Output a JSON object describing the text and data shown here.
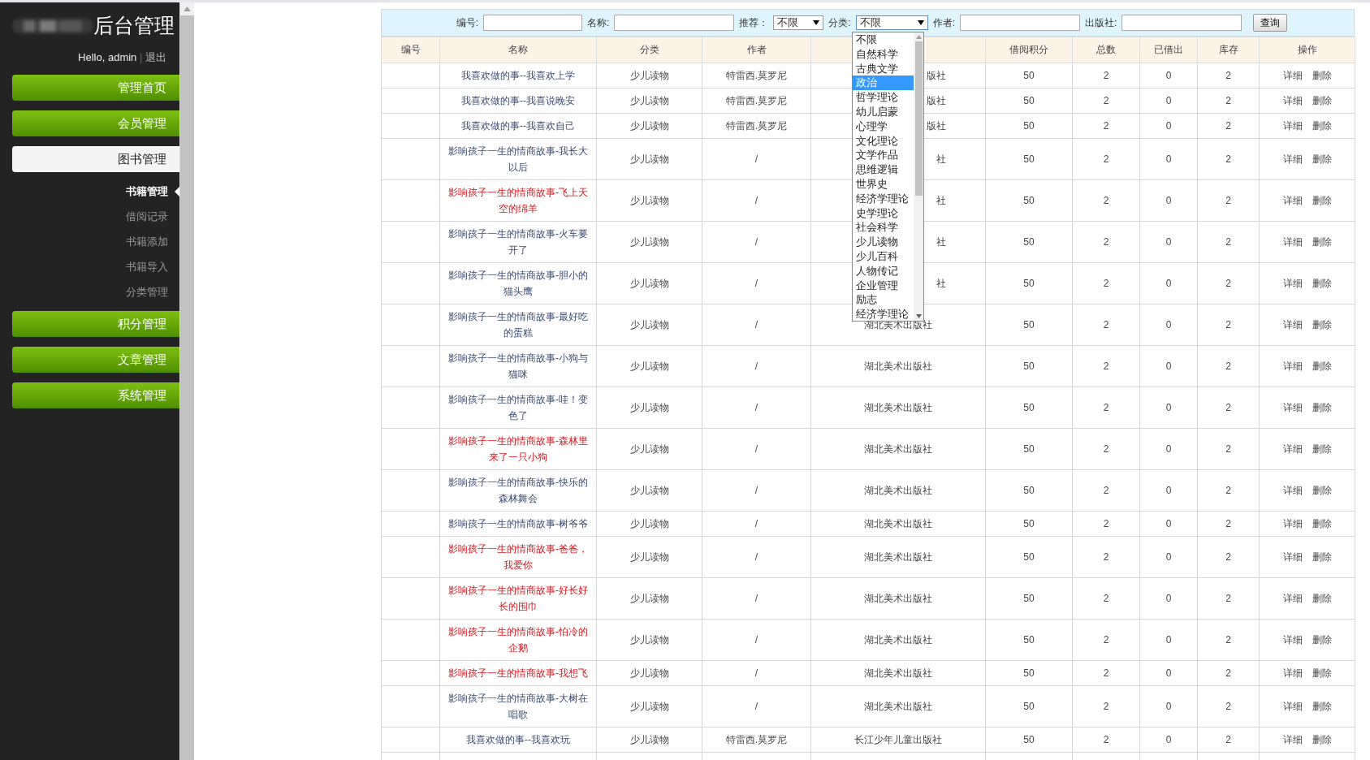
{
  "sidebar": {
    "title": "后台管理",
    "greeting": "Hello, admin",
    "separator": "|",
    "logout": "退出",
    "menu": [
      {
        "label": "管理首页",
        "selected": false
      },
      {
        "label": "会员管理",
        "selected": false
      },
      {
        "label": "图书管理",
        "selected": true,
        "children": [
          {
            "label": "书籍管理",
            "selected": true
          },
          {
            "label": "借阅记录",
            "selected": false
          },
          {
            "label": "书籍添加",
            "selected": false
          },
          {
            "label": "书籍导入",
            "selected": false
          },
          {
            "label": "分类管理",
            "selected": false
          }
        ]
      },
      {
        "label": "积分管理",
        "selected": false
      },
      {
        "label": "文章管理",
        "selected": false
      },
      {
        "label": "系统管理",
        "selected": false
      }
    ]
  },
  "search": {
    "fields": [
      {
        "kind": "input",
        "label": "编号:"
      },
      {
        "kind": "input",
        "label": "名称:"
      },
      {
        "kind": "select",
        "label": "推荐：",
        "value": "不限"
      },
      {
        "kind": "select",
        "label": "分类:",
        "value": "不限",
        "expanded": true
      },
      {
        "kind": "input",
        "label": "作者:"
      },
      {
        "kind": "input",
        "label": "出版社:"
      }
    ],
    "button": "查询",
    "options": [
      {
        "label": "不限",
        "selected": false
      },
      {
        "label": "自然科学",
        "selected": false
      },
      {
        "label": "古典文学",
        "selected": false
      },
      {
        "label": "政治",
        "selected": true
      },
      {
        "label": "哲学理论",
        "selected": false
      },
      {
        "label": "幼儿启蒙",
        "selected": false
      },
      {
        "label": "心理学",
        "selected": false
      },
      {
        "label": "文化理论",
        "selected": false
      },
      {
        "label": "文学作品",
        "selected": false
      },
      {
        "label": "思维逻辑",
        "selected": false
      },
      {
        "label": "世界史",
        "selected": false
      },
      {
        "label": "经济学理论",
        "selected": false
      },
      {
        "label": "史学理论",
        "selected": false
      },
      {
        "label": "社会科学",
        "selected": false
      },
      {
        "label": "少儿读物",
        "selected": false
      },
      {
        "label": "少儿百科",
        "selected": false
      },
      {
        "label": "人物传记",
        "selected": false
      },
      {
        "label": "企业管理",
        "selected": false
      },
      {
        "label": "励志",
        "selected": false
      },
      {
        "label": "经济学理论",
        "selected": false
      }
    ]
  },
  "table": {
    "columns": [
      {
        "label": "编号"
      },
      {
        "label": "名称"
      },
      {
        "label": "分类"
      },
      {
        "label": "作者"
      },
      {},
      {
        "label": "借阅积分"
      },
      {
        "label": "总数"
      },
      {
        "label": "已借出"
      },
      {
        "label": "库存"
      },
      {
        "label": "操作"
      }
    ],
    "rows": [
      {
        "name": "我喜欢做的事--我喜欢上学",
        "flagged": false,
        "category": "少儿读物",
        "author": "特雷西.莫罗尼",
        "publisher": "版社",
        "points": "50",
        "total": "2",
        "lent": "0",
        "stock": "2",
        "actions": [
          "详细",
          "删除"
        ]
      },
      {
        "name": "我喜欢做的事--我喜说晚安",
        "flagged": false,
        "category": "少儿读物",
        "author": "特雷西.莫罗尼",
        "publisher": "版社",
        "points": "50",
        "total": "2",
        "lent": "0",
        "stock": "2",
        "actions": [
          "详细",
          "删除"
        ]
      },
      {
        "name": "我喜欢做的事--我喜欢自己",
        "flagged": false,
        "category": "少儿读物",
        "author": "特雷西.莫罗尼",
        "publisher": "版社",
        "points": "50",
        "total": "2",
        "lent": "0",
        "stock": "2",
        "actions": [
          "详细",
          "删除"
        ]
      },
      {
        "name": "影响孩子一生的情商故事-我长大以后",
        "flagged": false,
        "category": "少儿读物",
        "author": "/",
        "publisher": "社",
        "points": "50",
        "total": "2",
        "lent": "0",
        "stock": "2",
        "actions": [
          "详细",
          "删除"
        ]
      },
      {
        "name": "影响孩子一生的情商故事-飞上天空的绵羊",
        "flagged": true,
        "category": "少儿读物",
        "author": "/",
        "publisher": "社",
        "points": "50",
        "total": "2",
        "lent": "0",
        "stock": "2",
        "actions": [
          "详细",
          "删除"
        ]
      },
      {
        "name": "影响孩子一生的情商故事-火车要开了",
        "flagged": false,
        "category": "少儿读物",
        "author": "/",
        "publisher": "社",
        "points": "50",
        "total": "2",
        "lent": "0",
        "stock": "2",
        "actions": [
          "详细",
          "删除"
        ]
      },
      {
        "name": "影响孩子一生的情商故事-胆小的猫头鹰",
        "flagged": false,
        "category": "少儿读物",
        "author": "/",
        "publisher": "社",
        "points": "50",
        "total": "2",
        "lent": "0",
        "stock": "2",
        "actions": [
          "详细",
          "删除"
        ]
      },
      {
        "name": "影响孩子一生的情商故事-最好吃的蛋糕",
        "flagged": false,
        "category": "少儿读物",
        "author": "/",
        "publisher": "湖北美术出版社",
        "points": "50",
        "total": "2",
        "lent": "0",
        "stock": "2",
        "actions": [
          "详细",
          "删除"
        ]
      },
      {
        "name": "影响孩子一生的情商故事-小狗与猫咪",
        "flagged": false,
        "category": "少儿读物",
        "author": "/",
        "publisher": "湖北美术出版社",
        "points": "50",
        "total": "2",
        "lent": "0",
        "stock": "2",
        "actions": [
          "详细",
          "删除"
        ]
      },
      {
        "name": "影响孩子一生的情商故事-哇！变色了",
        "flagged": false,
        "category": "少儿读物",
        "author": "/",
        "publisher": "湖北美术出版社",
        "points": "50",
        "total": "2",
        "lent": "0",
        "stock": "2",
        "actions": [
          "详细",
          "删除"
        ]
      },
      {
        "name": "影响孩子一生的情商故事-森林里来了一只小狗",
        "flagged": true,
        "category": "少儿读物",
        "author": "/",
        "publisher": "湖北美术出版社",
        "points": "50",
        "total": "2",
        "lent": "0",
        "stock": "2",
        "actions": [
          "详细",
          "删除"
        ]
      },
      {
        "name": "影响孩子一生的情商故事-快乐的森林舞会",
        "flagged": false,
        "category": "少儿读物",
        "author": "/",
        "publisher": "湖北美术出版社",
        "points": "50",
        "total": "2",
        "lent": "0",
        "stock": "2",
        "actions": [
          "详细",
          "删除"
        ]
      },
      {
        "name": "影响孩子一生的情商故事-树爷爷",
        "flagged": false,
        "category": "少儿读物",
        "author": "/",
        "publisher": "湖北美术出版社",
        "points": "50",
        "total": "2",
        "lent": "0",
        "stock": "2",
        "actions": [
          "详细",
          "删除"
        ]
      },
      {
        "name": "影响孩子一生的情商故事-爸爸，我爱你",
        "flagged": true,
        "category": "少儿读物",
        "author": "/",
        "publisher": "湖北美术出版社",
        "points": "50",
        "total": "2",
        "lent": "0",
        "stock": "2",
        "actions": [
          "详细",
          "删除"
        ]
      },
      {
        "name": "影响孩子一生的情商故事-好长好长的围巾",
        "flagged": true,
        "category": "少儿读物",
        "author": "/",
        "publisher": "湖北美术出版社",
        "points": "50",
        "total": "2",
        "lent": "0",
        "stock": "2",
        "actions": [
          "详细",
          "删除"
        ]
      },
      {
        "name": "影响孩子一生的情商故事-怕冷的企鹅",
        "flagged": true,
        "category": "少儿读物",
        "author": "/",
        "publisher": "湖北美术出版社",
        "points": "50",
        "total": "2",
        "lent": "0",
        "stock": "2",
        "actions": [
          "详细",
          "删除"
        ]
      },
      {
        "name": "影响孩子一生的情商故事-我想飞",
        "flagged": true,
        "category": "少儿读物",
        "author": "/",
        "publisher": "湖北美术出版社",
        "points": "50",
        "total": "2",
        "lent": "0",
        "stock": "2",
        "actions": [
          "详细",
          "删除"
        ]
      },
      {
        "name": "影响孩子一生的情商故事-大树在唱歌",
        "flagged": false,
        "category": "少儿读物",
        "author": "/",
        "publisher": "湖北美术出版社",
        "points": "50",
        "total": "2",
        "lent": "0",
        "stock": "2",
        "actions": [
          "详细",
          "删除"
        ]
      },
      {
        "name": "我喜欢做的事--我喜欢玩",
        "flagged": false,
        "category": "少儿读物",
        "author": "特雷西.莫罗尼",
        "publisher": "长江少年儿童出版社",
        "points": "50",
        "total": "2",
        "lent": "0",
        "stock": "2",
        "actions": [
          "详细",
          "删除"
        ]
      }
    ]
  }
}
